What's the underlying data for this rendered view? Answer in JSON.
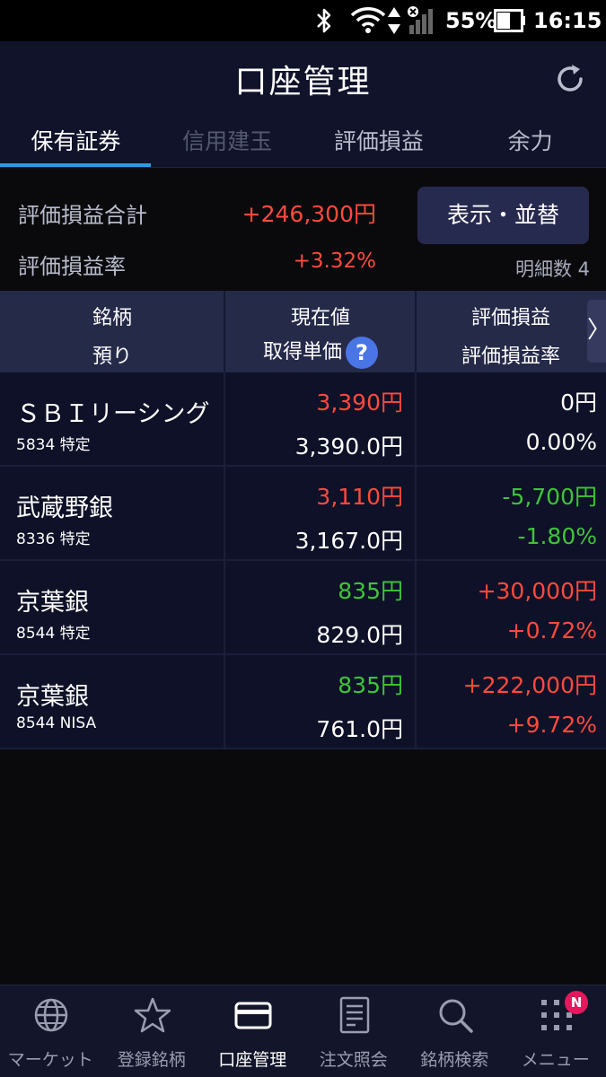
{
  "status_bar": {
    "battery": "55%",
    "time": "16:15"
  },
  "header": {
    "title": "口座管理"
  },
  "tabs": [
    {
      "label": "保有証券"
    },
    {
      "label": "信用建玉"
    },
    {
      "label": "評価損益"
    },
    {
      "label": "余力"
    }
  ],
  "summary": {
    "total_label": "評価損益合計",
    "total_value": "+246,300円",
    "rate_label": "評価損益率",
    "rate_value": "+3.32%",
    "sort_button": "表示・並替",
    "detail_count": "明細数 4"
  },
  "table_header": {
    "col1_top": "銘柄",
    "col1_bottom": "預り",
    "col2_top": "現在値",
    "col2_bottom": "取得単価",
    "col3_top": "評価損益",
    "col3_bottom": "評価損益率",
    "help": "?",
    "more": "〉"
  },
  "rows": [
    {
      "name": "ＳＢＩリーシング",
      "code": "5834 特定",
      "price": "3,390円",
      "cost": "3,390.0円",
      "pl": "0円",
      "rate": "0.00%"
    },
    {
      "name": "武蔵野銀",
      "code": "8336 特定",
      "price": "3,110円",
      "cost": "3,167.0円",
      "pl": "-5,700円",
      "rate": "-1.80%"
    },
    {
      "name": "京葉銀",
      "code": "8544 特定",
      "price": "835円",
      "cost": "829.0円",
      "pl": "+30,000円",
      "rate": "+0.72%"
    },
    {
      "name": "京葉銀",
      "code": "8544 NISA",
      "price": "835円",
      "cost": "761.0円",
      "pl": "+222,000円",
      "rate": "+9.72%"
    }
  ],
  "bottom_nav": [
    {
      "label": "マーケット",
      "icon": "globe-icon"
    },
    {
      "label": "登録銘柄",
      "icon": "star-icon"
    },
    {
      "label": "口座管理",
      "icon": "card-icon"
    },
    {
      "label": "注文照会",
      "icon": "document-icon"
    },
    {
      "label": "銘柄検索",
      "icon": "search-icon"
    },
    {
      "label": "メニュー",
      "icon": "grid-menu-icon"
    }
  ],
  "menu_badge": "N",
  "colors": {
    "up": "#ff4a3d",
    "down": "#3ec43a",
    "accent": "#2e9be0",
    "header_bg": "#10132a"
  }
}
